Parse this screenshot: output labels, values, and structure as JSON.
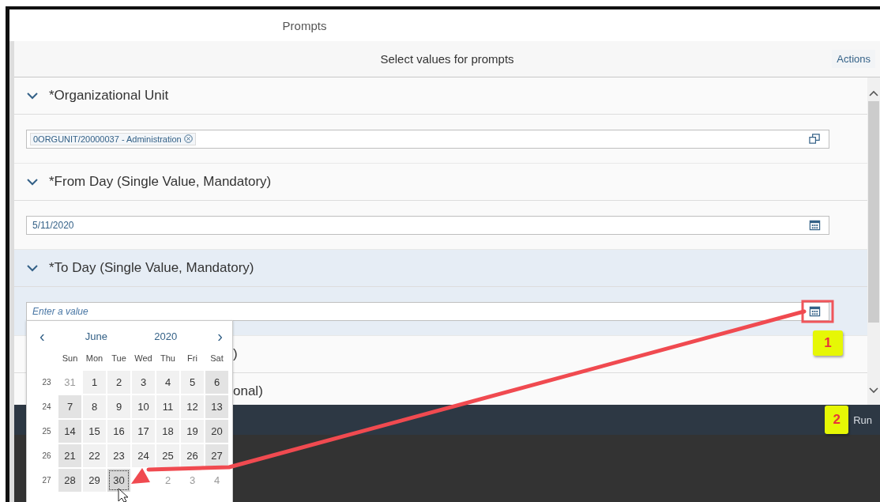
{
  "window": {
    "title": "Prompts"
  },
  "header": {
    "title": "Select values for prompts",
    "actions": "Actions"
  },
  "prompts": [
    {
      "kind": "full",
      "title": "*Organizational Unit",
      "expanded": true,
      "selected": false,
      "field": {
        "kind": "tokens",
        "tokens": [
          "0ORGUNIT/20000037 - Administration"
        ]
      }
    },
    {
      "kind": "full",
      "title": "*From Day (Single Value, Mandatory)",
      "expanded": true,
      "selected": false,
      "field": {
        "kind": "date",
        "value": "5/11/2020"
      }
    },
    {
      "kind": "full",
      "title": "*To Day (Single Value, Mandatory)",
      "expanded": true,
      "selected": true,
      "field": {
        "kind": "date",
        "placeholder": "Enter a value"
      }
    },
    {
      "kind": "partial",
      "title": ")"
    },
    {
      "kind": "partial",
      "title": "onal)"
    }
  ],
  "calendar": {
    "prev": "‹",
    "month": "June",
    "year": "2020",
    "next": "›",
    "weekdays": [
      "Sun",
      "Mon",
      "Tue",
      "Wed",
      "Thu",
      "Fri",
      "Sat"
    ],
    "weeks": [
      {
        "number": "23",
        "days": [
          {
            "day": "31",
            "outside": true,
            "focused": false
          },
          {
            "day": "1",
            "outside": false,
            "focused": false
          },
          {
            "day": "2",
            "outside": false,
            "focused": false
          },
          {
            "day": "3",
            "outside": false,
            "focused": false
          },
          {
            "day": "4",
            "outside": false,
            "focused": false
          },
          {
            "day": "5",
            "outside": false,
            "focused": false
          },
          {
            "day": "6",
            "outside": false,
            "focused": false
          }
        ]
      },
      {
        "number": "24",
        "days": [
          {
            "day": "7",
            "outside": false,
            "focused": false
          },
          {
            "day": "8",
            "outside": false,
            "focused": false
          },
          {
            "day": "9",
            "outside": false,
            "focused": false
          },
          {
            "day": "10",
            "outside": false,
            "focused": false
          },
          {
            "day": "11",
            "outside": false,
            "focused": false
          },
          {
            "day": "12",
            "outside": false,
            "focused": false
          },
          {
            "day": "13",
            "outside": false,
            "focused": false
          }
        ]
      },
      {
        "number": "25",
        "days": [
          {
            "day": "14",
            "outside": false,
            "focused": false
          },
          {
            "day": "15",
            "outside": false,
            "focused": false
          },
          {
            "day": "16",
            "outside": false,
            "focused": false
          },
          {
            "day": "17",
            "outside": false,
            "focused": false
          },
          {
            "day": "18",
            "outside": false,
            "focused": false
          },
          {
            "day": "19",
            "outside": false,
            "focused": false
          },
          {
            "day": "20",
            "outside": false,
            "focused": false
          }
        ]
      },
      {
        "number": "26",
        "days": [
          {
            "day": "21",
            "outside": false,
            "focused": false
          },
          {
            "day": "22",
            "outside": false,
            "focused": false
          },
          {
            "day": "23",
            "outside": false,
            "focused": false
          },
          {
            "day": "24",
            "outside": false,
            "focused": false
          },
          {
            "day": "25",
            "outside": false,
            "focused": false
          },
          {
            "day": "26",
            "outside": false,
            "focused": false
          },
          {
            "day": "27",
            "outside": false,
            "focused": false
          }
        ]
      },
      {
        "number": "27",
        "days": [
          {
            "day": "28",
            "outside": false,
            "focused": false
          },
          {
            "day": "29",
            "outside": false,
            "focused": false
          },
          {
            "day": "30",
            "outside": false,
            "focused": true
          },
          {
            "outside": true,
            "focused": false
          },
          {
            "day": "2",
            "outside": true,
            "focused": false
          },
          {
            "day": "3",
            "outside": true,
            "focused": false
          },
          {
            "day": "4",
            "outside": true,
            "focused": false
          }
        ]
      }
    ]
  },
  "footer": {
    "run": "Run"
  },
  "annotations": [
    {
      "label": "1"
    },
    {
      "label": "2"
    }
  ]
}
